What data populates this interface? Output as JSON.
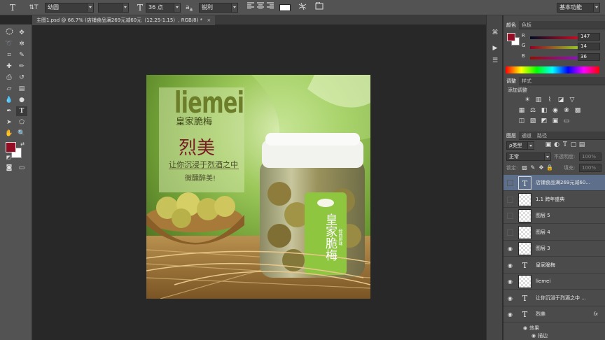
{
  "options_bar": {
    "tool_glyph": "T",
    "orient_glyph": "⇅T",
    "font_family": "幼圆",
    "font_style": "",
    "size_glyph": "T",
    "font_size": "36 点",
    "aa_glyph": "a",
    "aa_suffix": "a",
    "anti_alias": "锐利",
    "color_swatch": "#ffffff",
    "workspace": "基本功能"
  },
  "document": {
    "tab_title": "主图1.psd @ 66.7% (店铺食品满269元减60元（12.25-1.15）, RGB/8) *",
    "close_glyph": "×"
  },
  "artwork": {
    "brand_en": "liemei",
    "brand_cn_small": "皇家脆梅",
    "brand_cn_big": "烈美",
    "tagline": "让你沉浸于烈酒之中",
    "tagline2": "微醺醉美!",
    "jar_label": "皇家脆梅",
    "jar_label_small": "经典原味"
  },
  "color_panel": {
    "tabs": [
      "颜色",
      "色板"
    ],
    "r_label": "R",
    "r": "147",
    "g_label": "G",
    "g": "14",
    "b_label": "B",
    "b": "36",
    "foreground": "#930e24"
  },
  "adjust_panel": {
    "tabs": [
      "调整",
      "样式"
    ],
    "title": "添加调整"
  },
  "layers_panel": {
    "tabs": [
      "图层",
      "通道",
      "路径"
    ],
    "filter_kind": "ρ类型",
    "blend_mode": "正常",
    "opacity_label": "不透明度:",
    "opacity": "100%",
    "lock_label": "锁定:",
    "fill_label": "填充:",
    "fill": "100%",
    "layers": [
      {
        "name": "店铺食品满269元减60...",
        "type": "text",
        "visible": false,
        "selected": true
      },
      {
        "name": "1.1 跨年盛典",
        "type": "pixel",
        "visible": false
      },
      {
        "name": "图层 5",
        "type": "pixel",
        "visible": false
      },
      {
        "name": "图层 4",
        "type": "pixel",
        "visible": false
      },
      {
        "name": "图层 3",
        "type": "pixel",
        "visible": true
      },
      {
        "name": "皇家脆梅",
        "type": "text",
        "visible": true
      },
      {
        "name": "liemei",
        "type": "pixel",
        "visible": true
      },
      {
        "name": "让你沉浸于烈酒之中 ...",
        "type": "text",
        "visible": true
      },
      {
        "name": "烈美",
        "type": "text",
        "visible": true
      }
    ],
    "fx_badge": "fx",
    "effects_label": "效果",
    "stroke_label": "描边"
  }
}
